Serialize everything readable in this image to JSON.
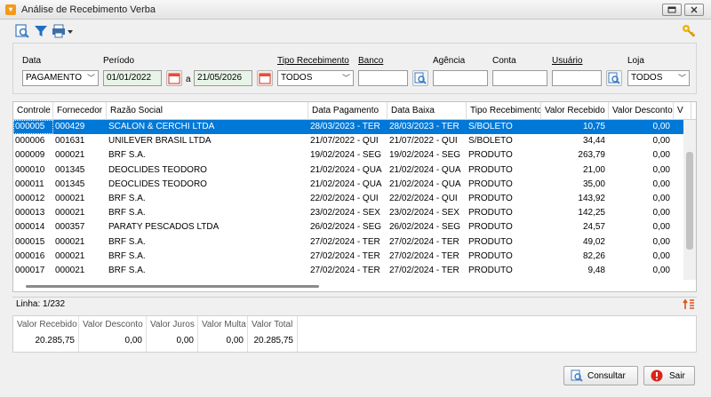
{
  "window": {
    "title": "Análise de Recebimento Verba"
  },
  "filters": {
    "data_label": "Data",
    "data_value": "PAGAMENTO",
    "periodo_label": "Período",
    "periodo_start": "01/01/2022",
    "periodo_sep": "a",
    "periodo_end": "21/05/2026",
    "tipo_label": "Tipo Recebimento",
    "tipo_value": "TODOS",
    "banco_label": "Banco",
    "agencia_label": "Agência",
    "conta_label": "Conta",
    "usuario_label": "Usuário",
    "loja_label": "Loja",
    "loja_value": "TODOS"
  },
  "grid": {
    "columns": [
      "Controle",
      "Fornecedor",
      "Razão Social",
      "Data Pagamento",
      "Data Baixa",
      "Tipo Recebimento",
      "Valor Recebido",
      "Valor Desconto",
      "V"
    ],
    "rows": [
      [
        "000005",
        "000429",
        "SCALON & CERCHI LTDA",
        "28/03/2023 - TER",
        "28/03/2023 - TER",
        "S/BOLETO",
        "10,75",
        "0,00"
      ],
      [
        "000006",
        "001631",
        "UNILEVER BRASIL LTDA",
        "21/07/2022 - QUI",
        "21/07/2022 - QUI",
        "S/BOLETO",
        "34,44",
        "0,00"
      ],
      [
        "000009",
        "000021",
        "BRF S.A.",
        "19/02/2024 - SEG",
        "19/02/2024 - SEG",
        "PRODUTO",
        "263,79",
        "0,00"
      ],
      [
        "000010",
        "001345",
        "DEOCLIDES TEODORO",
        "21/02/2024 - QUA",
        "21/02/2024 - QUA",
        "PRODUTO",
        "21,00",
        "0,00"
      ],
      [
        "000011",
        "001345",
        "DEOCLIDES TEODORO",
        "21/02/2024 - QUA",
        "21/02/2024 - QUA",
        "PRODUTO",
        "35,00",
        "0,00"
      ],
      [
        "000012",
        "000021",
        "BRF S.A.",
        "22/02/2024 - QUI",
        "22/02/2024 - QUI",
        "PRODUTO",
        "143,92",
        "0,00"
      ],
      [
        "000013",
        "000021",
        "BRF S.A.",
        "23/02/2024 - SEX",
        "23/02/2024 - SEX",
        "PRODUTO",
        "142,25",
        "0,00"
      ],
      [
        "000014",
        "000357",
        "PARATY PESCADOS LTDA",
        "26/02/2024 - SEG",
        "26/02/2024 - SEG",
        "PRODUTO",
        "24,57",
        "0,00"
      ],
      [
        "000015",
        "000021",
        "BRF S.A.",
        "27/02/2024 - TER",
        "27/02/2024 - TER",
        "PRODUTO",
        "49,02",
        "0,00"
      ],
      [
        "000016",
        "000021",
        "BRF S.A.",
        "27/02/2024 - TER",
        "27/02/2024 - TER",
        "PRODUTO",
        "82,26",
        "0,00"
      ],
      [
        "000017",
        "000021",
        "BRF S.A.",
        "27/02/2024 - TER",
        "27/02/2024 - TER",
        "PRODUTO",
        "9,48",
        "0,00"
      ]
    ]
  },
  "status": {
    "linha": "Linha: 1/232"
  },
  "totals": {
    "headers": [
      "Valor Recebido",
      "Valor Desconto",
      "Valor Juros",
      "Valor Multa",
      "Valor Total"
    ],
    "values": [
      "20.285,75",
      "0,00",
      "0,00",
      "0,00",
      "20.285,75"
    ]
  },
  "buttons": {
    "consultar": "Consultar",
    "sair": "Sair"
  }
}
